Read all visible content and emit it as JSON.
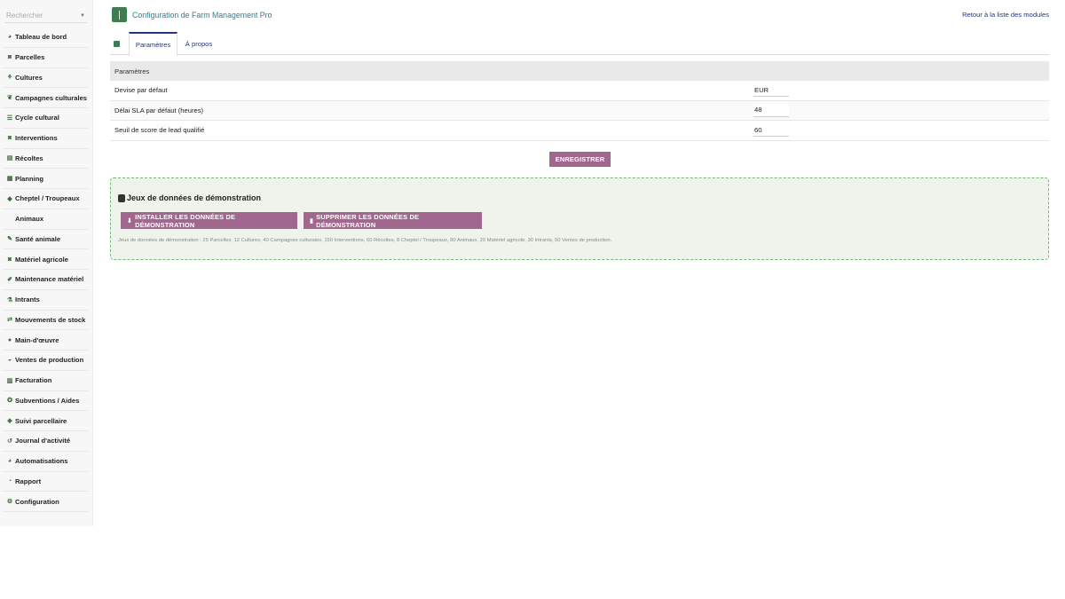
{
  "search": {
    "placeholder": "Rechercher"
  },
  "sidebar": {
    "items": [
      {
        "label": "Tableau de bord",
        "icon": "dashboard-icon",
        "glyph": "◕"
      },
      {
        "label": "Parcelles",
        "icon": "tractor-icon",
        "glyph": "◙"
      },
      {
        "label": "Cultures",
        "icon": "seedling-icon",
        "glyph": "⚘"
      },
      {
        "label": "Campagnes culturales",
        "icon": "leaf-icon",
        "glyph": "❦"
      },
      {
        "label": "Cycle cultural",
        "icon": "list-icon",
        "glyph": "☰"
      },
      {
        "label": "Interventions",
        "icon": "tractor-icon",
        "glyph": "◙"
      },
      {
        "label": "Récoltes",
        "icon": "archive-icon",
        "glyph": "▤"
      },
      {
        "label": "Planning",
        "icon": "calendar-icon",
        "glyph": "▦"
      },
      {
        "label": "Cheptel / Troupeaux",
        "icon": "cow-icon",
        "glyph": "◆"
      },
      {
        "label": "Animaux",
        "icon": "",
        "glyph": "",
        "sub": true
      },
      {
        "label": "Santé animale",
        "icon": "syringe-icon",
        "glyph": "✎"
      },
      {
        "label": "Matériel agricole",
        "icon": "tractor-icon",
        "glyph": "◙"
      },
      {
        "label": "Maintenance matériel",
        "icon": "wrench-icon",
        "glyph": "✐"
      },
      {
        "label": "Intrants",
        "icon": "flask-icon",
        "glyph": "⚗"
      },
      {
        "label": "Mouvements de stock",
        "icon": "exchange-icon",
        "glyph": "⇄"
      },
      {
        "label": "Main-d'œuvre",
        "icon": "user-icon",
        "glyph": "●"
      },
      {
        "label": "Ventes de production",
        "icon": "hand-coins-icon",
        "glyph": "◒"
      },
      {
        "label": "Facturation",
        "icon": "invoice-icon",
        "glyph": "▥"
      },
      {
        "label": "Subventions / Aides",
        "icon": "award-icon",
        "glyph": "✪"
      },
      {
        "label": "Suivi parcellaire",
        "icon": "map-icon",
        "glyph": "◈"
      },
      {
        "label": "Journal d'activité",
        "icon": "history-icon",
        "glyph": "↺"
      },
      {
        "label": "Automatisations",
        "icon": "robot-icon",
        "glyph": "◕"
      },
      {
        "label": "Rapport",
        "icon": "chart-icon",
        "glyph": "◔"
      },
      {
        "label": "Configuration",
        "icon": "gear-icon",
        "glyph": "⚙"
      }
    ]
  },
  "header": {
    "title": "Configuration de Farm Management Pro",
    "back_link": "Retour à la liste des modules"
  },
  "tabs": [
    {
      "label": "Paramètres",
      "active": true
    },
    {
      "label": "À propos",
      "active": false
    }
  ],
  "settings": {
    "header": "Paramètres",
    "rows": [
      {
        "label": "Devise par défaut",
        "value": "EUR"
      },
      {
        "label": "Délai SLA par défaut (heures)",
        "value": "48"
      },
      {
        "label": "Seuil de score de lead qualifié",
        "value": "60"
      }
    ],
    "save_label": "ENREGISTRER"
  },
  "demo": {
    "title": "Jeux de données de démonstration",
    "install_label": "INSTALLER LES DONNÉES DE DÉMONSTRATION",
    "delete_label": "SUPPRIMER LES DONNÉES DE DÉMONSTRATION",
    "info": "Jeux de données de démonstration : 25 Parcelles, 12 Cultures, 40 Campagnes culturales, 150 Interventions, 60 Récoltes, 8 Cheptel / Troupeaux, 80 Animaux, 20 Matériel agricole, 30 Intrants, 50 Ventes de production."
  },
  "colors": {
    "accent": "#a2678e",
    "brand_green": "#3d7d52",
    "title_teal": "#2f7d8d",
    "link_navy": "#25367a"
  }
}
